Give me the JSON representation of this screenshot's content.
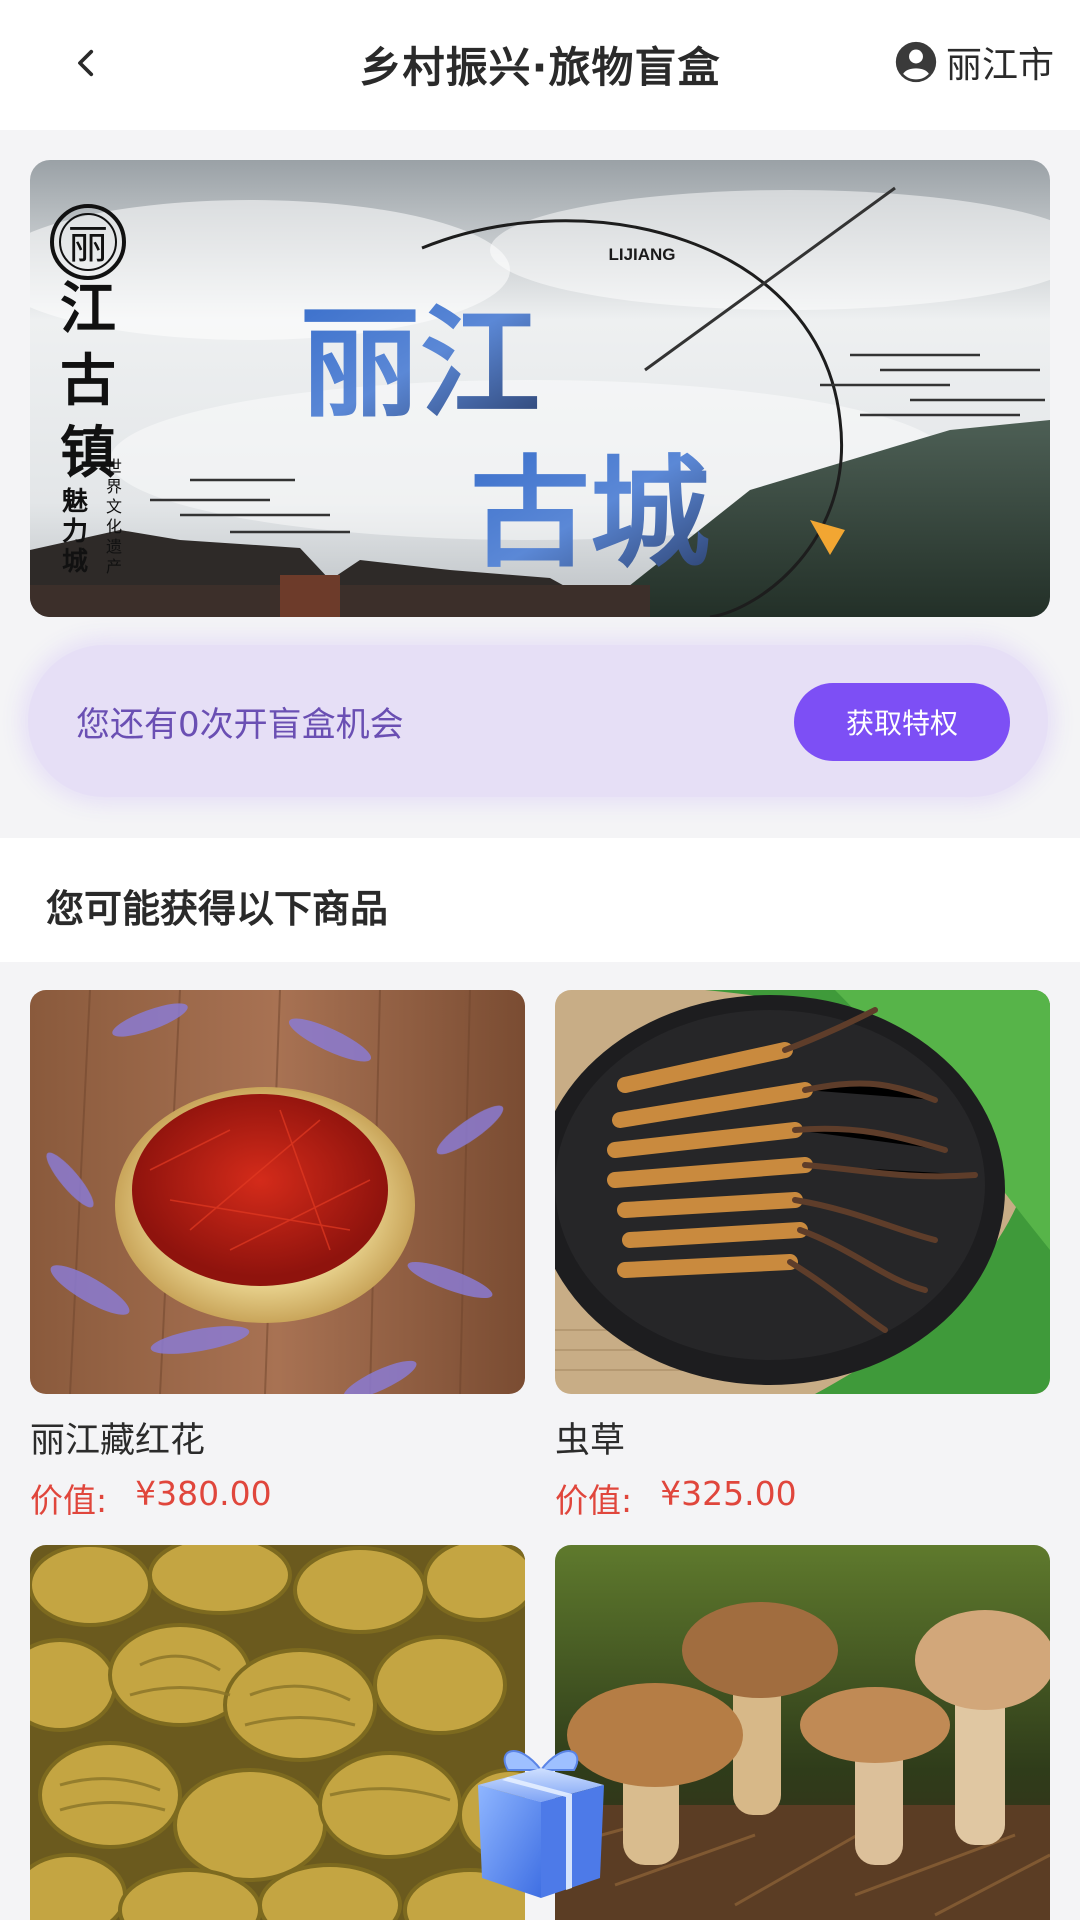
{
  "header": {
    "title": "乡村振兴·旅物盲盒",
    "location": "丽江市"
  },
  "banner": {
    "brand_vertical": "江古镇",
    "brand_sub": "魅力城",
    "brand_tag": "世界文化遗产",
    "brand_circle": "丽",
    "tag": "LIJIANG",
    "headline_line1": "丽江",
    "headline_line2": "古城"
  },
  "chance": {
    "text": "您还有0次开盲盒机会",
    "button": "获取特权"
  },
  "section": {
    "title": "您可能获得以下商品"
  },
  "products": [
    {
      "name": "丽江藏红花",
      "price_label": "价值:",
      "price": "¥380.00"
    },
    {
      "name": "虫草",
      "price_label": "价值:",
      "price": "¥325.00"
    },
    {
      "name": "",
      "price_label": "",
      "price": ""
    },
    {
      "name": "",
      "price_label": "",
      "price": ""
    }
  ],
  "colors": {
    "accent": "#7d4ff5",
    "price": "#e0463c",
    "chance_bg": "#e6dff6"
  }
}
